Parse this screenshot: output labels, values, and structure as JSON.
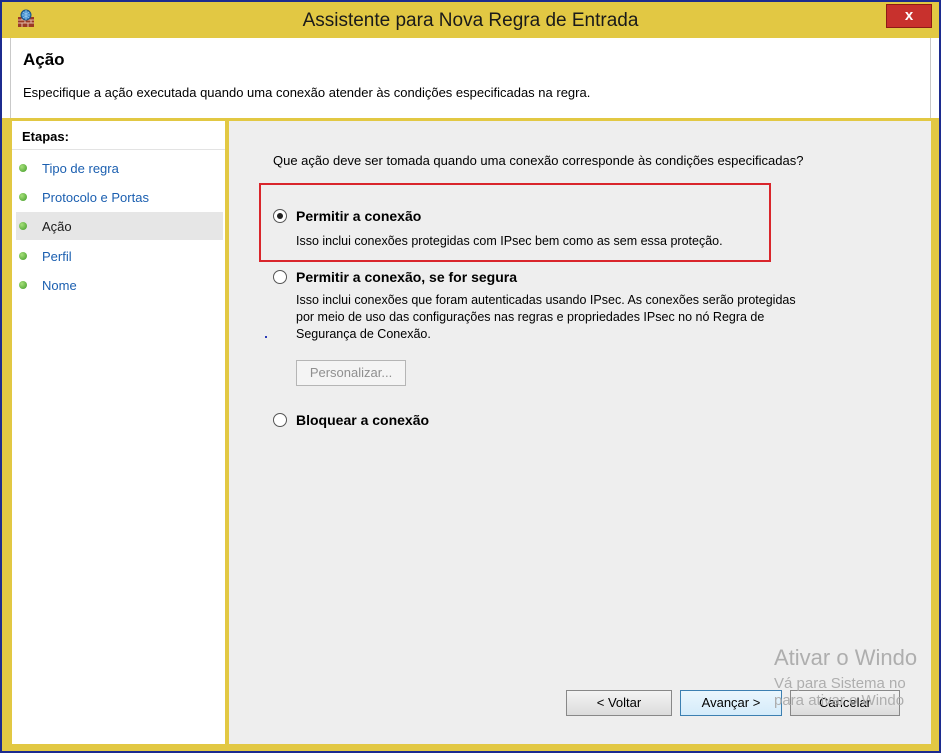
{
  "window": {
    "title": "Assistente para Nova Regra de Entrada",
    "close_label": "x"
  },
  "header": {
    "title": "Ação",
    "description": "Especifique a ação executada quando uma conexão atender às condições especificadas na regra."
  },
  "sidebar": {
    "heading": "Etapas:",
    "items": [
      {
        "label": "Tipo de regra"
      },
      {
        "label": "Protocolo e Portas"
      },
      {
        "label": "Ação"
      },
      {
        "label": "Perfil"
      },
      {
        "label": "Nome"
      }
    ],
    "active_index": 2
  },
  "main": {
    "question": "Que ação deve ser tomada quando uma conexão corresponde às condições especificadas?",
    "options": [
      {
        "title": "Permitir a conexão",
        "description": "Isso inclui conexões protegidas com IPsec bem como as sem essa proteção.",
        "selected": true
      },
      {
        "title": "Permitir a conexão, se for segura",
        "description_lines": [
          "Isso inclui conexões que foram autenticadas usando IPsec. As conexões serão protegidas",
          "por meio de uso das configurações nas regras e propriedades IPsec no nó Regra de",
          "Segurança de Conexão."
        ],
        "selected": false
      },
      {
        "title": "Bloquear a conexão",
        "selected": false
      }
    ],
    "customize_label": "Personalizar..."
  },
  "footer": {
    "back_label": "< Voltar",
    "next_label": "Avançar >",
    "cancel_label": "Cancelar"
  },
  "watermark": {
    "line1": "Ativar o Windo",
    "line2": "Vá para Sistema no",
    "line3": "para ativar o Windo"
  },
  "colors": {
    "titlebar": "#e2c843",
    "highlight_border": "#d9252b",
    "link": "#1b5fb0",
    "step_dot": "#3f9a26"
  }
}
